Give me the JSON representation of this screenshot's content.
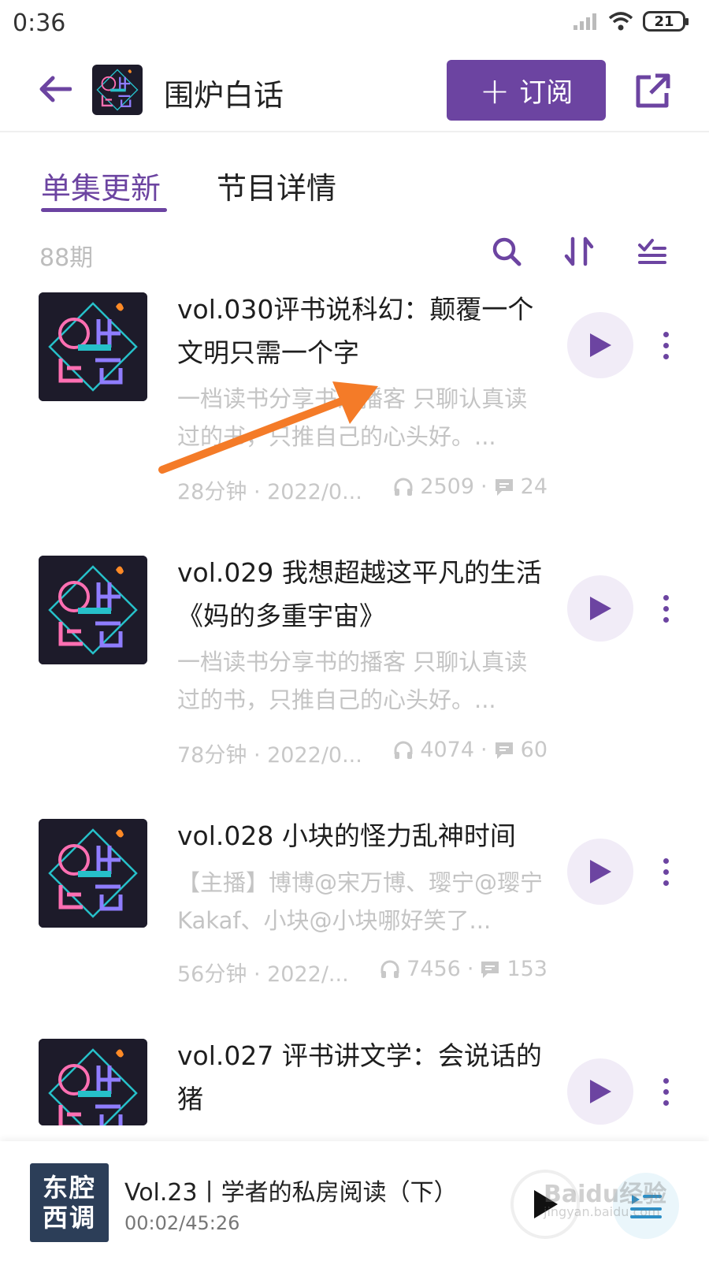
{
  "status_bar": {
    "time": "0:36",
    "battery": "21"
  },
  "header": {
    "title": "围炉白话",
    "subscribe_label": "订阅"
  },
  "tabs": [
    {
      "label": "单集更新"
    },
    {
      "label": "节目详情"
    }
  ],
  "episode_count": "88期",
  "episodes": [
    {
      "title": "vol.030评书说科幻：颠覆一个文明只需一个字",
      "description": "一档读书分享书的播客 只聊认真读过的书，只推自己的心头好。...",
      "duration_date": "28分钟 · 2022/0...",
      "plays": "2509",
      "comments": "24"
    },
    {
      "title": "vol.029 我想超越这平凡的生活《妈的多重宇宙》",
      "description": "一档读书分享书的播客 只聊认真读过的书，只推自己的心头好。...",
      "duration_date": "78分钟 · 2022/0...",
      "plays": "4074",
      "comments": "60"
    },
    {
      "title": "vol.028 小块的怪力乱神时间",
      "description": "【主播】博博@宋万博、璎宁@璎宁Kakaf、小块@小块哪好笑了...",
      "duration_date": "56分钟 · 2022/...",
      "plays": "7456",
      "comments": "153"
    },
    {
      "title": "vol.027 评书讲文学：会说话的猪",
      "description": "",
      "duration_date": "",
      "plays": "",
      "comments": ""
    }
  ],
  "player": {
    "cover_line1": "东腔",
    "cover_line2": "西调",
    "title": "Vol.23丨学者的私房阅读（下）",
    "time": "00:02/45:26",
    "progress": 0.001
  },
  "watermark": {
    "text": "Baidu经验",
    "sub": "jingyan.baidu.com"
  },
  "colors": {
    "accent": "#6c44a1",
    "annotation": "#f47b28"
  }
}
